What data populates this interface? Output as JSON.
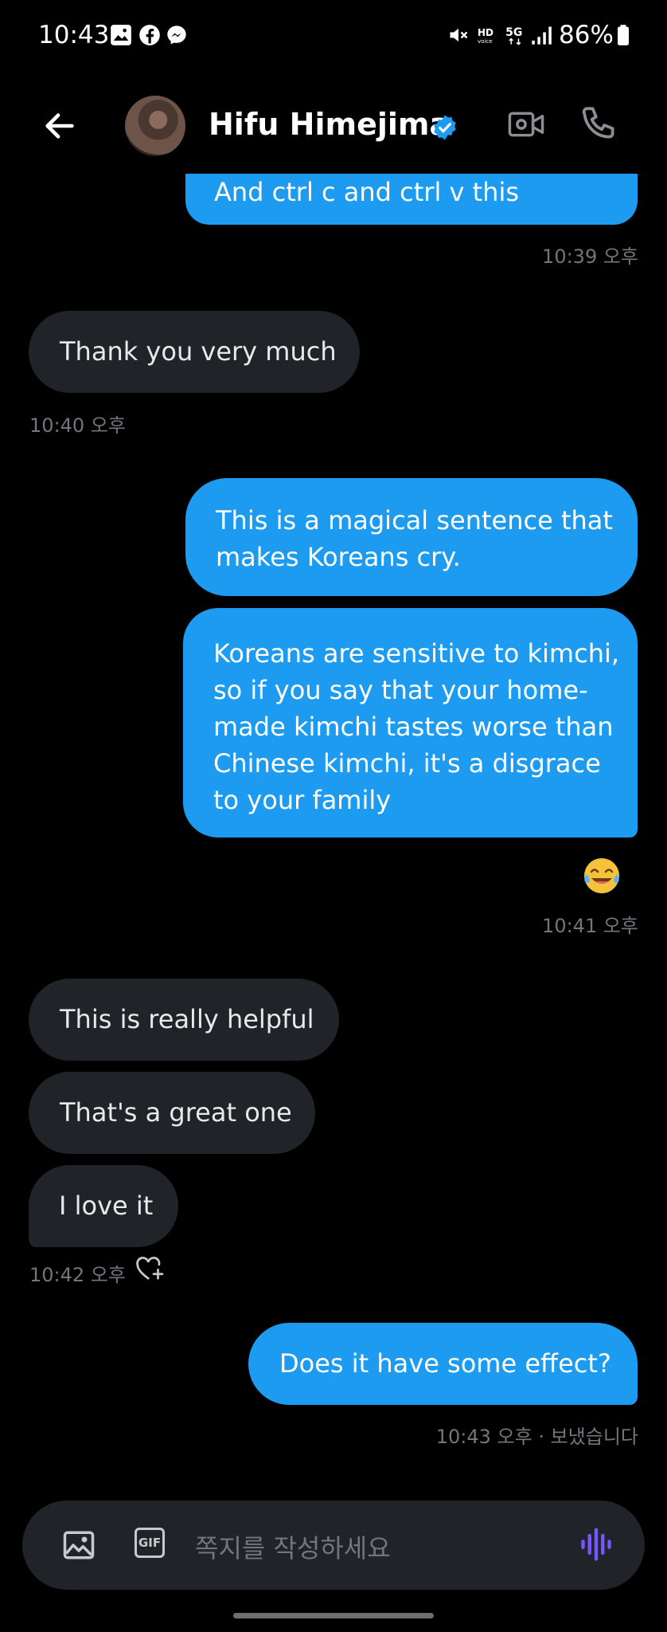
{
  "status_bar": {
    "time": "10:43",
    "battery": "86%",
    "icons": [
      "gallery-icon",
      "facebook-icon",
      "messenger-icon",
      "mute-icon",
      "hd-voice-icon",
      "5g-icon",
      "signal-icon",
      "battery-icon"
    ]
  },
  "header": {
    "name": "Hifu Himejima",
    "verified": true,
    "icons": [
      "back-arrow-icon",
      "verified-badge-icon",
      "video-call-icon",
      "phone-icon"
    ]
  },
  "messages": [
    {
      "id": "m1",
      "direction": "out",
      "text": "And ctrl c and ctrl v this",
      "timestamp": "10:39 오후"
    },
    {
      "id": "m2",
      "direction": "in",
      "text": "Thank you very much",
      "timestamp": "10:40 오후"
    },
    {
      "id": "m3",
      "direction": "out",
      "text": "This is a magical sentence that makes Koreans cry."
    },
    {
      "id": "m4",
      "direction": "out",
      "text": "Koreans are sensitive to kimchi, so if you say that your home-made kimchi tastes worse than Chinese kimchi, it's a disgrace to your family",
      "reaction": "😂",
      "timestamp": "10:41 오후"
    },
    {
      "id": "m5",
      "direction": "in",
      "text": "This is really helpful"
    },
    {
      "id": "m6",
      "direction": "in",
      "text": "That's a great one"
    },
    {
      "id": "m7",
      "direction": "in",
      "text": "I love it",
      "timestamp": "10:42 오후"
    },
    {
      "id": "m8",
      "direction": "out",
      "text": "Does it have some effect?",
      "timestamp": "10:43 오후 · 보냈습니다"
    }
  ],
  "composer": {
    "placeholder": "쪽지를 작성하세요",
    "gif_label": "GIF"
  },
  "colors": {
    "background": "#000000",
    "outgoing_bubble": "#1d9bf0",
    "incoming_bubble": "#202327",
    "timestamp": "#71767b",
    "voice_accent": "#7856ff"
  }
}
